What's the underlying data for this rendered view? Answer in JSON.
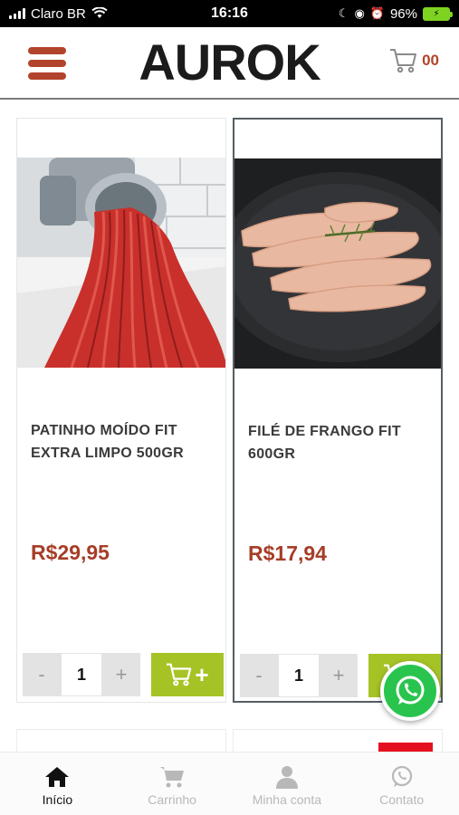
{
  "status_bar": {
    "carrier": "Claro BR",
    "time": "16:16",
    "battery": "96%"
  },
  "header": {
    "logo": "AUROK",
    "cart_count": "00"
  },
  "products": [
    {
      "name": "PATINHO MOÍDO FIT EXTRA LIMPO 500GR",
      "price": "R$29,95",
      "quantity": "1",
      "minus": "-",
      "plus": "+"
    },
    {
      "name": "FILÉ DE FRANGO FIT 600GR",
      "price": "R$17,94",
      "quantity": "1",
      "minus": "-",
      "plus": "+"
    }
  ],
  "bottom_nav": [
    {
      "label": "Início",
      "icon": "home-icon"
    },
    {
      "label": "Carrinho",
      "icon": "cart-icon"
    },
    {
      "label": "Minha conta",
      "icon": "user-icon"
    },
    {
      "label": "Contato",
      "icon": "whatsapp-icon"
    }
  ],
  "colors": {
    "brand": "#b2442b",
    "price": "#a63d27",
    "add_button": "#a6c326",
    "whatsapp": "#29c44e"
  }
}
